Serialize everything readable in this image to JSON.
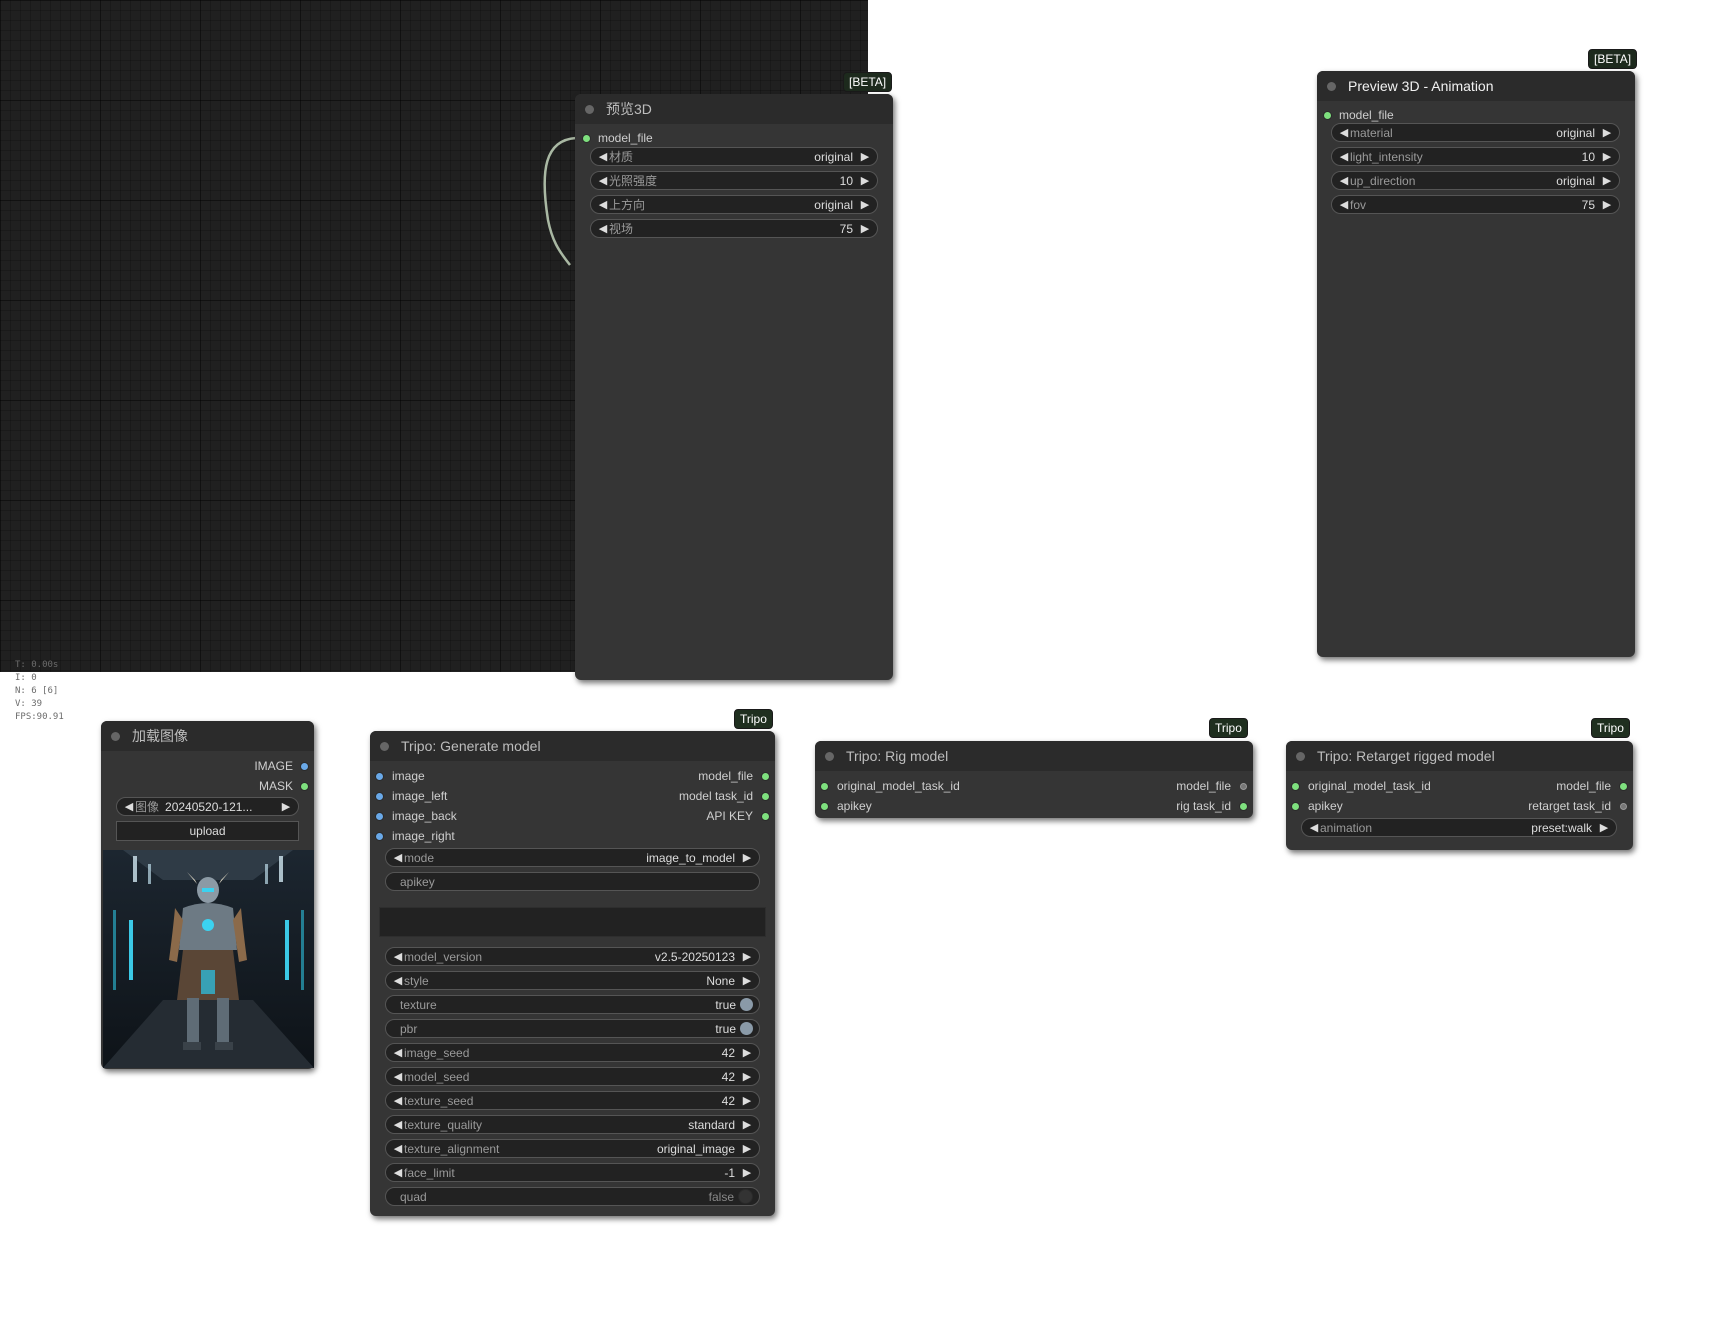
{
  "stats": {
    "lines": [
      "T: 0.00s",
      "I: 0",
      "N: 6 [6]",
      "V: 39",
      "FPS:90.91"
    ]
  },
  "nodes": {
    "preview3d": {
      "title": "预览3D",
      "badge": "[BETA]",
      "input": "model_file",
      "widgets": [
        {
          "label": "材质",
          "value": "original"
        },
        {
          "label": "光照强度",
          "value": "10"
        },
        {
          "label": "上方向",
          "value": "original"
        },
        {
          "label": "视场",
          "value": "75"
        }
      ]
    },
    "preview3d_anim": {
      "title": "Preview 3D - Animation",
      "badge": "[BETA]",
      "input": "model_file",
      "widgets": [
        {
          "label": "material",
          "value": "original"
        },
        {
          "label": "light_intensity",
          "value": "10"
        },
        {
          "label": "up_direction",
          "value": "original"
        },
        {
          "label": "fov",
          "value": "75"
        }
      ]
    },
    "load_image": {
      "title": "加载图像",
      "outputs": [
        "IMAGE",
        "MASK"
      ],
      "image_label": "图像",
      "image_value": "20240520-121...",
      "upload_label": "upload"
    },
    "tripo_generate": {
      "title": "Tripo: Generate model",
      "badge": "Tripo",
      "inputs": [
        "image",
        "image_left",
        "image_back",
        "image_right"
      ],
      "outputs": [
        "model_file",
        "model task_id",
        "API KEY"
      ],
      "mode": {
        "label": "mode",
        "value": "image_to_model"
      },
      "apikey": "apikey",
      "widgets": [
        {
          "label": "model_version",
          "value": "v2.5-20250123",
          "kind": "combo"
        },
        {
          "label": "style",
          "value": "None",
          "kind": "combo"
        },
        {
          "label": "texture",
          "value": "true",
          "kind": "toggle"
        },
        {
          "label": "pbr",
          "value": "true",
          "kind": "toggle"
        },
        {
          "label": "image_seed",
          "value": "42",
          "kind": "combo"
        },
        {
          "label": "model_seed",
          "value": "42",
          "kind": "combo"
        },
        {
          "label": "texture_seed",
          "value": "42",
          "kind": "combo"
        },
        {
          "label": "texture_quality",
          "value": "standard",
          "kind": "combo"
        },
        {
          "label": "texture_alignment",
          "value": "original_image",
          "kind": "combo"
        },
        {
          "label": "face_limit",
          "value": "-1",
          "kind": "combo"
        },
        {
          "label": "quad",
          "value": "false",
          "kind": "toggle-off"
        }
      ]
    },
    "tripo_rig": {
      "title": "Tripo: Rig model",
      "badge": "Tripo",
      "inputs": [
        "original_model_task_id",
        "apikey"
      ],
      "outputs": [
        "model_file",
        "rig task_id"
      ]
    },
    "tripo_retarget": {
      "title": "Tripo: Retarget rigged model",
      "badge": "Tripo",
      "inputs": [
        "original_model_task_id",
        "apikey"
      ],
      "outputs": [
        "model_file",
        "retarget task_id"
      ],
      "animation": {
        "label": "animation",
        "value": "preset:walk"
      }
    }
  },
  "colors": {
    "slot_green": "#7ee07e",
    "slot_blue": "#6aa9e8",
    "canvas": "#202020",
    "node": "#353535"
  }
}
